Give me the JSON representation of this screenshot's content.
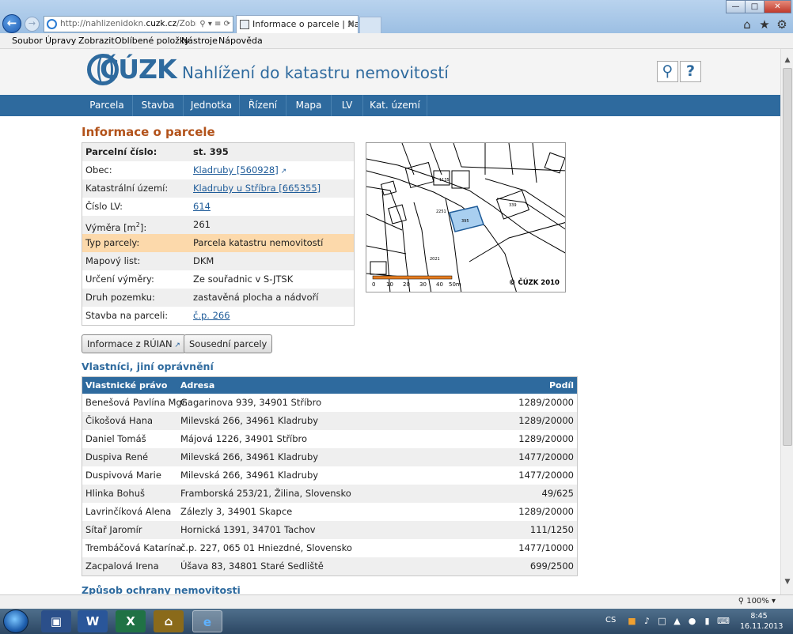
{
  "browser": {
    "address_pre": "http://nahlizenidokn.",
    "address_domain": "cuzk.cz",
    "address_post": "/ZobrazOb",
    "tab_title": "Informace o parcele | Nahlí...",
    "zoom": "100%"
  },
  "menu": [
    "Soubor",
    "Úpravy",
    "Zobrazit",
    "Oblíbené položky",
    "Nástroje",
    "Nápověda"
  ],
  "site": {
    "logo": "ČÚZK",
    "title": "Nahlížení do katastru nemovitostí"
  },
  "nav": [
    "Parcela",
    "Stavba",
    "Jednotka",
    "Řízení",
    "Mapa",
    "LV",
    "Kat. území"
  ],
  "page": {
    "heading": "Informace o parcele"
  },
  "parcel": [
    {
      "label": "Parcelní číslo:",
      "value": "st. 395"
    },
    {
      "label": "Obec:",
      "value": "Kladruby [560928]"
    },
    {
      "label": "Katastrální území:",
      "value": "Kladruby u Stříbra [665355]"
    },
    {
      "label": "Číslo LV:",
      "value": "614"
    },
    {
      "label": "Výměra [m",
      "label_sup": "2",
      "label_end": "]:",
      "value": "261"
    },
    {
      "label": "Typ parcely:",
      "value": "Parcela katastru nemovitostí"
    },
    {
      "label": "Mapový list:",
      "value": "DKM"
    },
    {
      "label": "Určení výměry:",
      "value": "Ze souřadnic v S-JTSK"
    },
    {
      "label": "Druh pozemku:",
      "value": "zastavěná plocha a nádvoří"
    },
    {
      "label": "Stavba na parceli:",
      "value": "č.p. 266"
    }
  ],
  "map": {
    "copyright": "© ČÚZK 2010",
    "scale_ticks": [
      "0",
      "10",
      "20",
      "30",
      "40",
      "50m"
    ],
    "parcel_labels": [
      "395",
      "339",
      "2251",
      "2021",
      "1135"
    ]
  },
  "buttons": {
    "ruian": "Informace z RÚIAN",
    "neighbors": "Sousední parcely"
  },
  "owners_heading": "Vlastníci, jiní oprávnění",
  "owners_columns": [
    "Vlastnické právo",
    "Adresa",
    "Podíl"
  ],
  "owners": [
    {
      "name": "Benešová Pavlína Mgr.",
      "address": "Gagarinova 939, 34901 Stříbro",
      "share": "1289/20000"
    },
    {
      "name": "Čikošová Hana",
      "address": "Milevská 266, 34961 Kladruby",
      "share": "1289/20000"
    },
    {
      "name": "Daniel Tomáš",
      "address": "Májová 1226, 34901 Stříbro",
      "share": "1289/20000"
    },
    {
      "name": "Duspiva René",
      "address": "Milevská 266, 34961 Kladruby",
      "share": "1477/20000"
    },
    {
      "name": "Duspivová Marie",
      "address": "Milevská 266, 34961 Kladruby",
      "share": "1477/20000"
    },
    {
      "name": "Hlinka Bohuš",
      "address": "Framborská 253/21, Žilina, Slovensko",
      "share": "49/625"
    },
    {
      "name": "Lavrinčíková Alena",
      "address": "Zálezly 3, 34901 Skapce",
      "share": "1289/20000"
    },
    {
      "name": "Sítař Jaromír",
      "address": "Hornická 1391, 34701 Tachov",
      "share": "111/1250"
    },
    {
      "name": "Trembáčová Katarína",
      "address": "č.p. 227, 065 01 Hniezdné, Slovensko",
      "share": "1477/10000"
    },
    {
      "name": "Zacpalová Irena",
      "address": "Úšava 83, 34801 Staré Sedliště",
      "share": "699/2500"
    }
  ],
  "protection_heading": "Způsob ochrany nemovitosti",
  "taskbar": {
    "lang": "CS",
    "time": "8:45",
    "date": "16.11.2013"
  },
  "colors": {
    "brand": "#2e6a9e",
    "heading": "#b2521a",
    "highlight": "#fcd9ab",
    "parcel_fill": "#a9cff0"
  }
}
